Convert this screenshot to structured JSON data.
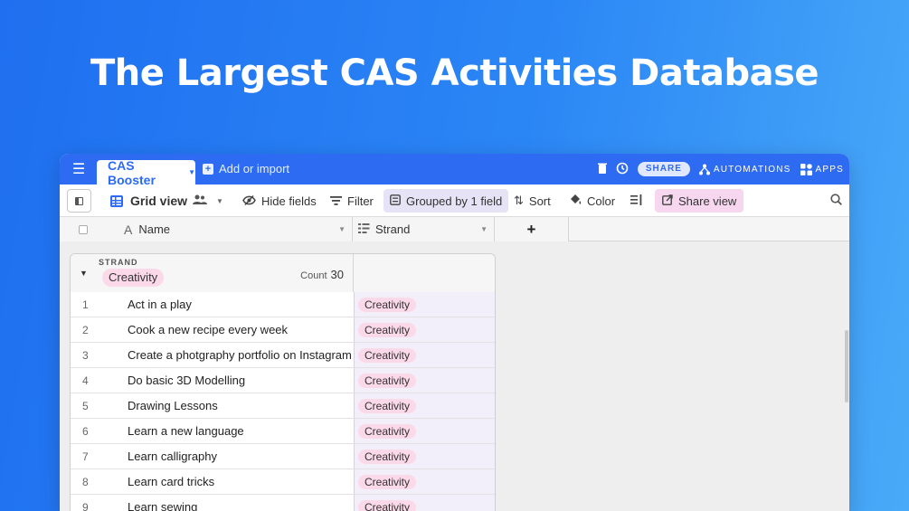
{
  "headline": "The Largest CAS Activities Database",
  "topbar": {
    "base_name": "CAS Booster",
    "add_import": "Add or import",
    "share_label": "SHARE",
    "automations_label": "AUTOMATIONS",
    "apps_label": "APPS"
  },
  "toolbar": {
    "view_name": "Grid view",
    "hide_fields": "Hide fields",
    "filter": "Filter",
    "grouped": "Grouped by 1 field",
    "sort": "Sort",
    "color": "Color",
    "share_view": "Share view"
  },
  "columns": {
    "name": "Name",
    "strand": "Strand",
    "add": "+"
  },
  "group": {
    "field_label": "STRAND",
    "value": "Creativity",
    "count_label": "Count",
    "count": "30"
  },
  "rows": [
    {
      "num": "1",
      "name": "Act in a play",
      "strand": "Creativity"
    },
    {
      "num": "2",
      "name": "Cook a new recipe every week",
      "strand": "Creativity"
    },
    {
      "num": "3",
      "name": "Create a photgraphy portfolio on Instagram",
      "strand": "Creativity"
    },
    {
      "num": "4",
      "name": "Do basic 3D Modelling",
      "strand": "Creativity"
    },
    {
      "num": "5",
      "name": "Drawing Lessons",
      "strand": "Creativity"
    },
    {
      "num": "6",
      "name": "Learn a new language",
      "strand": "Creativity"
    },
    {
      "num": "7",
      "name": "Learn calligraphy",
      "strand": "Creativity"
    },
    {
      "num": "8",
      "name": "Learn card tricks",
      "strand": "Creativity"
    },
    {
      "num": "9",
      "name": "Learn sewing",
      "strand": "Creativity"
    }
  ],
  "colors": {
    "accent": "#2d6bf3",
    "pill": "#fbd9e8",
    "grouped_bg": "#e5e3f5",
    "share_view_bg": "#f7d7ef"
  }
}
